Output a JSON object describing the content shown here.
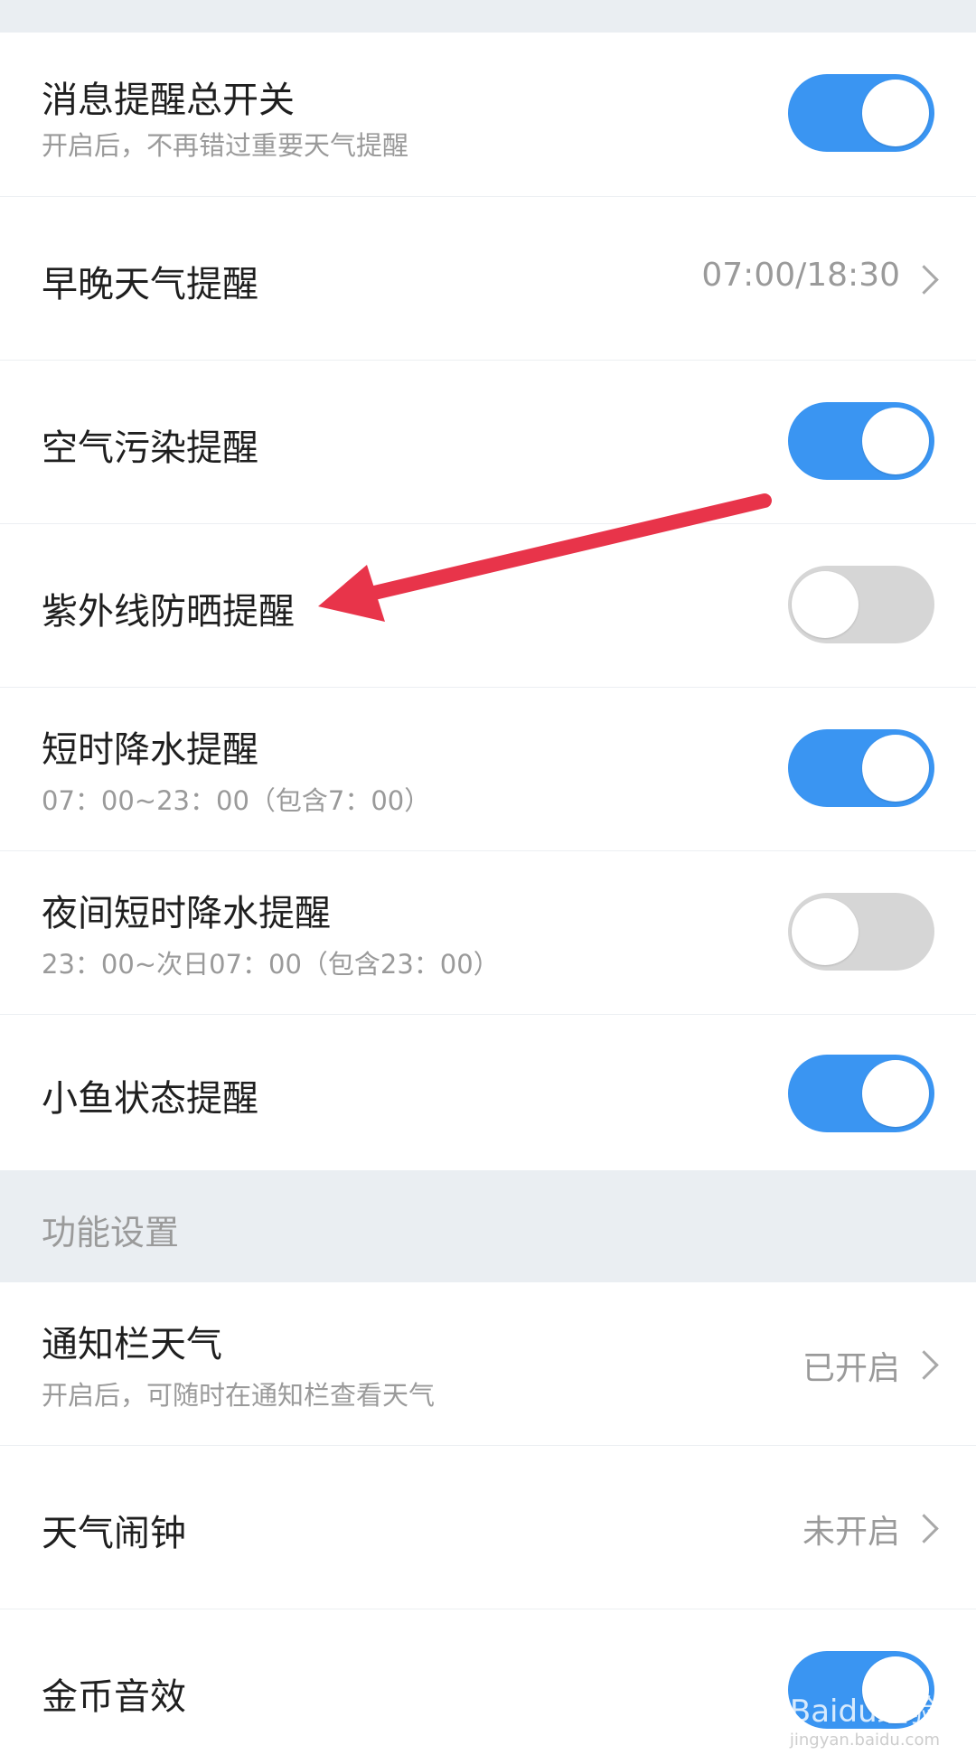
{
  "colors": {
    "accent": "#3a95f2",
    "off": "#d6d6d6",
    "arrow": "#e8344a"
  },
  "notifications": {
    "master": {
      "title": "消息提醒总开关",
      "subtitle": "开启后，不再错过重要天气提醒",
      "on": true
    },
    "morning_evening": {
      "title": "早晚天气提醒",
      "value": "07:00/18:30",
      "icon": "chevron-right-icon"
    },
    "air_pollution": {
      "title": "空气污染提醒",
      "on": true
    },
    "uv": {
      "title": "紫外线防晒提醒",
      "on": false
    },
    "short_rain": {
      "title": "短时降水提醒",
      "subtitle": "07：00~23：00（包含7：00）",
      "on": true
    },
    "night_rain": {
      "title": "夜间短时降水提醒",
      "subtitle": "23：00~次日07：00（包含23：00）",
      "on": false
    },
    "fish": {
      "title": "小鱼状态提醒",
      "on": true
    }
  },
  "section_function": {
    "label": "功能设置"
  },
  "functions": {
    "notif_bar": {
      "title": "通知栏天气",
      "subtitle": "开启后，可随时在通知栏查看天气",
      "value": "已开启"
    },
    "alarm": {
      "title": "天气闹钟",
      "value": "未开启"
    },
    "coin_sound": {
      "title": "金币音效",
      "on": true
    }
  },
  "watermark": {
    "text": "Baidu经验",
    "url": "jingyan.baidu.com"
  }
}
